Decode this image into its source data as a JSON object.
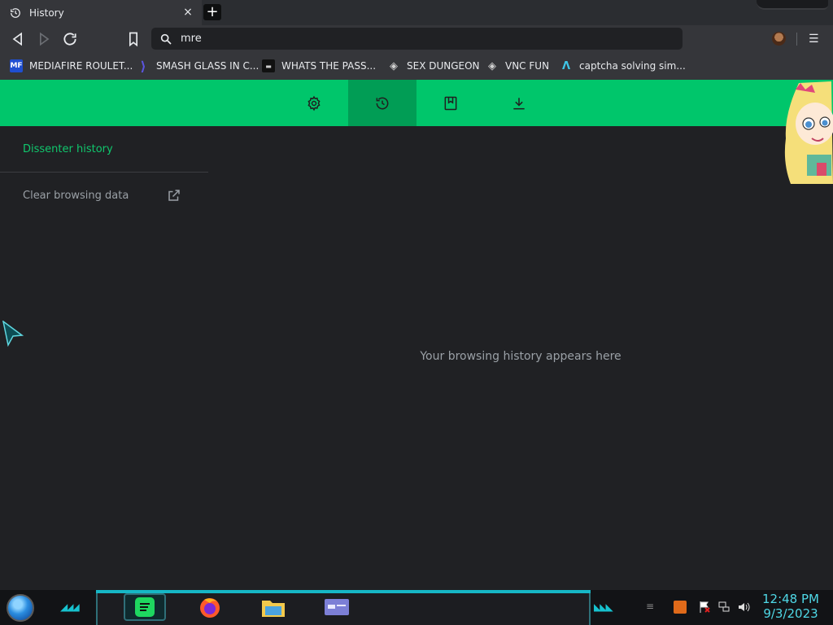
{
  "tab": {
    "title": "History",
    "icon": "history-icon",
    "close": "×"
  },
  "new_tab": "+",
  "nav": {
    "back": "back-icon",
    "forward": "forward-icon",
    "reload": "reload-icon",
    "bookmark": "bookmark-icon"
  },
  "omnibox": {
    "value": "mre",
    "icon": "search-icon"
  },
  "menu_glyph": "☰",
  "bookmarks": [
    {
      "label": "MEDIAFIRE ROULET...",
      "fav": "MF",
      "fav_bg": "#1f4fd1",
      "fav_fg": "#ffffff"
    },
    {
      "label": "SMASH GLASS IN C...",
      "fav": "⟩",
      "fav_bg": "#35363a",
      "fav_fg": "#5b55e0"
    },
    {
      "label": "WHATS THE PASS...",
      "fav": "▬",
      "fav_bg": "#111111",
      "fav_fg": "#cccccc"
    },
    {
      "label": "SEX DUNGEON",
      "fav": "◈",
      "fav_bg": "#35363a",
      "fav_fg": "#d0d0d0"
    },
    {
      "label": "VNC FUN",
      "fav": "◈",
      "fav_bg": "#35363a",
      "fav_fg": "#d0d0d0"
    },
    {
      "label": "captcha solving sim...",
      "fav": "Λ",
      "fav_bg": "#35363a",
      "fav_fg": "#3fc7e8"
    }
  ],
  "green_tabs": [
    {
      "icon": "settings-gear-icon",
      "active": false
    },
    {
      "icon": "history-icon",
      "active": true
    },
    {
      "icon": "bookmarks-icon",
      "active": false
    },
    {
      "icon": "download-icon",
      "active": false
    }
  ],
  "sidebar": {
    "title": "Dissenter history",
    "clear": "Clear browsing data"
  },
  "empty_message": "Your browsing history appears here",
  "taskbar": {
    "apps": [
      "spotify-icon",
      "firefox-icon",
      "file-explorer-icon",
      "window-app-icon"
    ],
    "time": "12:48 PM",
    "date": "9/3/2023"
  },
  "colors": {
    "accent": "#00c66b",
    "accent_active": "#019d55",
    "page_bg": "#202124",
    "clock": "#4fd8e6"
  }
}
